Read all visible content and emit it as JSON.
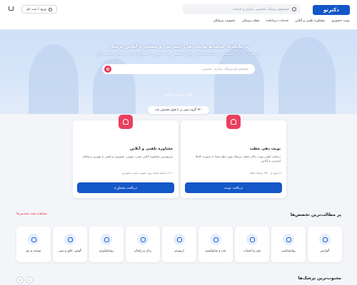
{
  "header": {
    "logo": "دکترتو",
    "search_placeholder": "جستجوی پزشک، تخصص، بیماری و خدمات",
    "login_label": "ورود / ثبت نام",
    "nav": [
      "نوبت حضوری",
      "مشاوره تلفنی و آنلاین",
      "خدمات درمانکده",
      "مجله پزشکی",
      "عضویت پزشکان"
    ]
  },
  "hero": {
    "title": "درمانکده؛ سامانه نوبت دهی اینترنتی و مشاوره آنلاین پزشک",
    "subtitle": "از بیش از ۵۰۰۰ روانشناس و پزشک متخصص و فوق تخصص نوبت حضوری، مشاوره آنلاین و مشاوره تلفنی بگیر",
    "search_placeholder": "جستجو نام پزشک، بیماری، تخصص...",
    "online_label": "آنلاین مشاوره آنلاین",
    "pill_label": "۳۲۰ گروه پیش بر با فوق تخصص عدد"
  },
  "cards": [
    {
      "title": "نوبت دهی مطب",
      "desc": "دریافت اولین نوبت خالی مطب پزشک مورد نظر شما به صورت کاملا اینترنتی و آنلاین",
      "meta": "۸ بیش از ۱۲۴۰ پزشک فعال",
      "cta": "دریافت نوبت"
    },
    {
      "title": "مشاوره تلفنی و آنلاین",
      "desc": "سریع‌ترین مشاوره آنلاین متنی، صوتی، تصویری و تلفنی با بهترین پزشکان",
      "meta": "۲۰ ۴ ساعته شبانه روز، صوتی، متنی، تصویری",
      "cta": "دریافت مشاوره"
    }
  ],
  "specialties": {
    "title": "پر مطالب‌ترین تخصص‌ها",
    "see_all": "مشاهده همه تخصص‌ها",
    "items": [
      "گوارش",
      "روانشناسی",
      "مغز و اعصاب",
      "غدد و متابولیسم",
      "ارتوپدی",
      "زنان و زایمان",
      "روماتولوژی",
      "گوش، حلق و بینی",
      "پوست و مو"
    ]
  },
  "popular": {
    "title": "محبوب‌ترین پزشک‌ها"
  },
  "colors": {
    "primary": "#1457c8",
    "accent": "#e73659"
  }
}
